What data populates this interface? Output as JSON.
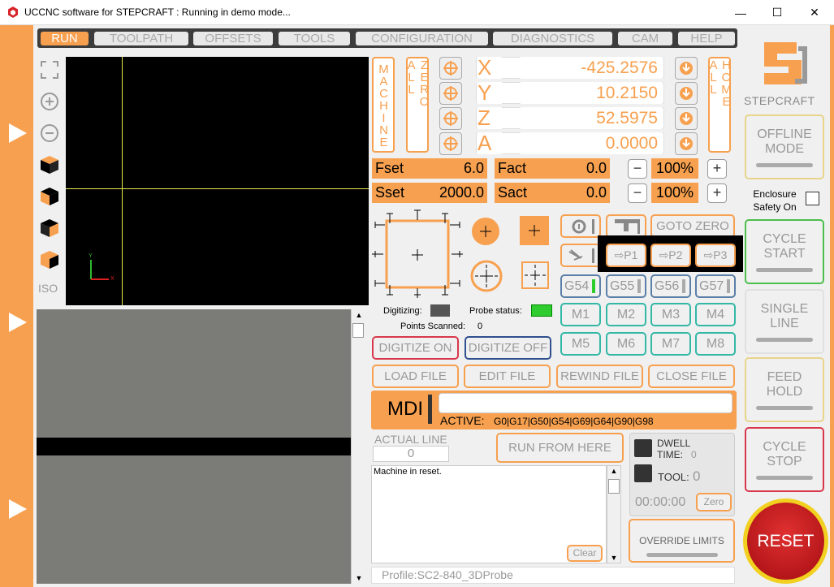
{
  "window": {
    "title": "UCCNC software for STEPCRAFT : Running in demo mode...",
    "minimize": "—",
    "maximize": "☐",
    "close": "✕"
  },
  "menu": [
    "RUN",
    "TOOLPATH",
    "OFFSETS",
    "TOOLS",
    "CONFIGURATION",
    "DIAGNOSTICS",
    "CAM",
    "HELP"
  ],
  "viewer": {
    "iso_label": "ISO",
    "axis_y": "Y",
    "axis_x": "X"
  },
  "dro": {
    "machine": "MACHINE",
    "zero_all": "ZERO ALL",
    "home_all": "HOME ALL",
    "axes": [
      {
        "name": "X",
        "value": "-425.2576"
      },
      {
        "name": "Y",
        "value": "10.2150"
      },
      {
        "name": "Z",
        "value": "52.5975"
      },
      {
        "name": "A",
        "value": "0.0000"
      }
    ]
  },
  "feed": {
    "fset_label": "Fset",
    "fset": "6.0",
    "fact_label": "Fact",
    "fact": "0.0",
    "sset_label": "Sset",
    "sset": "2000.0",
    "sact_label": "Sact",
    "sact": "0.0",
    "feed_pct": "100%",
    "spindle_pct": "100%",
    "minus": "−",
    "plus": "+"
  },
  "probe": {
    "digitizing": "Digitizing:",
    "probe_status": "Probe status:",
    "points_scanned": "Points Scanned:",
    "points": "0",
    "digitize_on": "DIGITIZE ON",
    "digitize_off": "DIGITIZE OFF"
  },
  "goto_zero": "GOTO ZERO",
  "positions": [
    "P1",
    "P2",
    "P3"
  ],
  "work_offsets": [
    "G54",
    "G55",
    "G56",
    "G57"
  ],
  "macros": [
    "M1",
    "M2",
    "M3",
    "M4",
    "M5",
    "M6",
    "M7",
    "M8"
  ],
  "file": {
    "load": "LOAD FILE",
    "edit": "EDIT FILE",
    "rewind": "REWIND FILE",
    "close": "CLOSE FILE"
  },
  "mdi": {
    "label": "MDI",
    "active_label": "ACTIVE:",
    "active": "G0|G17|G50|G54|G69|G64|G90|G98",
    "input": ""
  },
  "actual_line": {
    "label": "ACTUAL LINE",
    "value": "0"
  },
  "run_from_here": "RUN FROM HERE",
  "status": {
    "dwell": "DWELL",
    "dwell_time": "TIME:",
    "dwell_value": "0",
    "tool": "TOOL:",
    "tool_value": "0",
    "timer": "00:00:00",
    "zero": "Zero"
  },
  "console": {
    "message": "Machine in reset.",
    "clear": "Clear"
  },
  "profile": "Profile:SC2-840_3DProbe",
  "override_limits": "OVERRIDE LIMITS",
  "right": {
    "brand": "STEPCRAFT",
    "offline": "OFFLINE MODE",
    "enclosure": "Enclosure Safety On",
    "cycle_start": "CYCLE START",
    "single_line": "SINGLE LINE",
    "feed_hold": "FEED HOLD",
    "cycle_stop": "CYCLE STOP",
    "reset": "RESET"
  },
  "colors": {
    "accent": "#F7A04F",
    "reset_red": "#c0161b",
    "cycle_start_green": "#4bbf4b",
    "cycle_stop_red": "#d8374b"
  }
}
